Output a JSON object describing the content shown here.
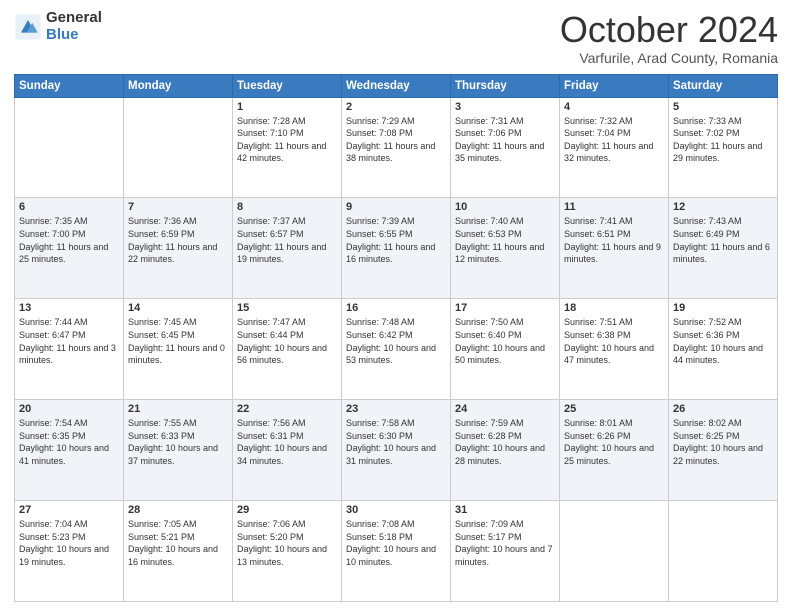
{
  "header": {
    "logo_general": "General",
    "logo_blue": "Blue",
    "title": "October 2024",
    "location": "Varfurile, Arad County, Romania"
  },
  "days_of_week": [
    "Sunday",
    "Monday",
    "Tuesday",
    "Wednesday",
    "Thursday",
    "Friday",
    "Saturday"
  ],
  "weeks": [
    [
      {
        "day": "",
        "sunrise": "",
        "sunset": "",
        "daylight": ""
      },
      {
        "day": "",
        "sunrise": "",
        "sunset": "",
        "daylight": ""
      },
      {
        "day": "1",
        "sunrise": "Sunrise: 7:28 AM",
        "sunset": "Sunset: 7:10 PM",
        "daylight": "Daylight: 11 hours and 42 minutes."
      },
      {
        "day": "2",
        "sunrise": "Sunrise: 7:29 AM",
        "sunset": "Sunset: 7:08 PM",
        "daylight": "Daylight: 11 hours and 38 minutes."
      },
      {
        "day": "3",
        "sunrise": "Sunrise: 7:31 AM",
        "sunset": "Sunset: 7:06 PM",
        "daylight": "Daylight: 11 hours and 35 minutes."
      },
      {
        "day": "4",
        "sunrise": "Sunrise: 7:32 AM",
        "sunset": "Sunset: 7:04 PM",
        "daylight": "Daylight: 11 hours and 32 minutes."
      },
      {
        "day": "5",
        "sunrise": "Sunrise: 7:33 AM",
        "sunset": "Sunset: 7:02 PM",
        "daylight": "Daylight: 11 hours and 29 minutes."
      }
    ],
    [
      {
        "day": "6",
        "sunrise": "Sunrise: 7:35 AM",
        "sunset": "Sunset: 7:00 PM",
        "daylight": "Daylight: 11 hours and 25 minutes."
      },
      {
        "day": "7",
        "sunrise": "Sunrise: 7:36 AM",
        "sunset": "Sunset: 6:59 PM",
        "daylight": "Daylight: 11 hours and 22 minutes."
      },
      {
        "day": "8",
        "sunrise": "Sunrise: 7:37 AM",
        "sunset": "Sunset: 6:57 PM",
        "daylight": "Daylight: 11 hours and 19 minutes."
      },
      {
        "day": "9",
        "sunrise": "Sunrise: 7:39 AM",
        "sunset": "Sunset: 6:55 PM",
        "daylight": "Daylight: 11 hours and 16 minutes."
      },
      {
        "day": "10",
        "sunrise": "Sunrise: 7:40 AM",
        "sunset": "Sunset: 6:53 PM",
        "daylight": "Daylight: 11 hours and 12 minutes."
      },
      {
        "day": "11",
        "sunrise": "Sunrise: 7:41 AM",
        "sunset": "Sunset: 6:51 PM",
        "daylight": "Daylight: 11 hours and 9 minutes."
      },
      {
        "day": "12",
        "sunrise": "Sunrise: 7:43 AM",
        "sunset": "Sunset: 6:49 PM",
        "daylight": "Daylight: 11 hours and 6 minutes."
      }
    ],
    [
      {
        "day": "13",
        "sunrise": "Sunrise: 7:44 AM",
        "sunset": "Sunset: 6:47 PM",
        "daylight": "Daylight: 11 hours and 3 minutes."
      },
      {
        "day": "14",
        "sunrise": "Sunrise: 7:45 AM",
        "sunset": "Sunset: 6:45 PM",
        "daylight": "Daylight: 11 hours and 0 minutes."
      },
      {
        "day": "15",
        "sunrise": "Sunrise: 7:47 AM",
        "sunset": "Sunset: 6:44 PM",
        "daylight": "Daylight: 10 hours and 56 minutes."
      },
      {
        "day": "16",
        "sunrise": "Sunrise: 7:48 AM",
        "sunset": "Sunset: 6:42 PM",
        "daylight": "Daylight: 10 hours and 53 minutes."
      },
      {
        "day": "17",
        "sunrise": "Sunrise: 7:50 AM",
        "sunset": "Sunset: 6:40 PM",
        "daylight": "Daylight: 10 hours and 50 minutes."
      },
      {
        "day": "18",
        "sunrise": "Sunrise: 7:51 AM",
        "sunset": "Sunset: 6:38 PM",
        "daylight": "Daylight: 10 hours and 47 minutes."
      },
      {
        "day": "19",
        "sunrise": "Sunrise: 7:52 AM",
        "sunset": "Sunset: 6:36 PM",
        "daylight": "Daylight: 10 hours and 44 minutes."
      }
    ],
    [
      {
        "day": "20",
        "sunrise": "Sunrise: 7:54 AM",
        "sunset": "Sunset: 6:35 PM",
        "daylight": "Daylight: 10 hours and 41 minutes."
      },
      {
        "day": "21",
        "sunrise": "Sunrise: 7:55 AM",
        "sunset": "Sunset: 6:33 PM",
        "daylight": "Daylight: 10 hours and 37 minutes."
      },
      {
        "day": "22",
        "sunrise": "Sunrise: 7:56 AM",
        "sunset": "Sunset: 6:31 PM",
        "daylight": "Daylight: 10 hours and 34 minutes."
      },
      {
        "day": "23",
        "sunrise": "Sunrise: 7:58 AM",
        "sunset": "Sunset: 6:30 PM",
        "daylight": "Daylight: 10 hours and 31 minutes."
      },
      {
        "day": "24",
        "sunrise": "Sunrise: 7:59 AM",
        "sunset": "Sunset: 6:28 PM",
        "daylight": "Daylight: 10 hours and 28 minutes."
      },
      {
        "day": "25",
        "sunrise": "Sunrise: 8:01 AM",
        "sunset": "Sunset: 6:26 PM",
        "daylight": "Daylight: 10 hours and 25 minutes."
      },
      {
        "day": "26",
        "sunrise": "Sunrise: 8:02 AM",
        "sunset": "Sunset: 6:25 PM",
        "daylight": "Daylight: 10 hours and 22 minutes."
      }
    ],
    [
      {
        "day": "27",
        "sunrise": "Sunrise: 7:04 AM",
        "sunset": "Sunset: 5:23 PM",
        "daylight": "Daylight: 10 hours and 19 minutes."
      },
      {
        "day": "28",
        "sunrise": "Sunrise: 7:05 AM",
        "sunset": "Sunset: 5:21 PM",
        "daylight": "Daylight: 10 hours and 16 minutes."
      },
      {
        "day": "29",
        "sunrise": "Sunrise: 7:06 AM",
        "sunset": "Sunset: 5:20 PM",
        "daylight": "Daylight: 10 hours and 13 minutes."
      },
      {
        "day": "30",
        "sunrise": "Sunrise: 7:08 AM",
        "sunset": "Sunset: 5:18 PM",
        "daylight": "Daylight: 10 hours and 10 minutes."
      },
      {
        "day": "31",
        "sunrise": "Sunrise: 7:09 AM",
        "sunset": "Sunset: 5:17 PM",
        "daylight": "Daylight: 10 hours and 7 minutes."
      },
      {
        "day": "",
        "sunrise": "",
        "sunset": "",
        "daylight": ""
      },
      {
        "day": "",
        "sunrise": "",
        "sunset": "",
        "daylight": ""
      }
    ]
  ]
}
